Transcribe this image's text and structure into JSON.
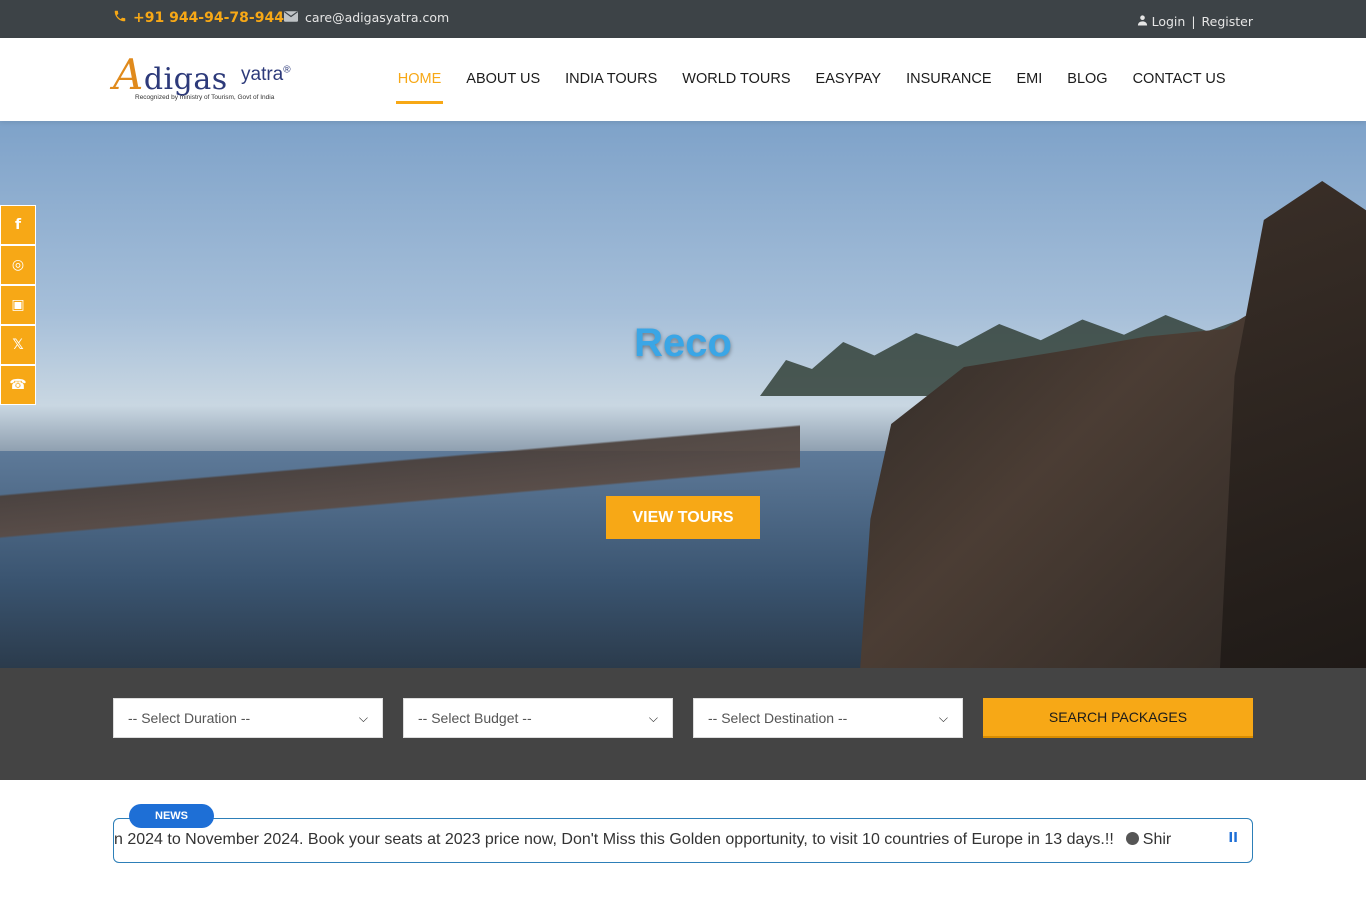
{
  "topbar": {
    "phone": "+91 944-94-78-944",
    "email": "care@adigasyatra.com",
    "login": "Login",
    "register": "Register"
  },
  "logo": {
    "brand_initial": "A",
    "brand_rest": "digas",
    "sub": "yatra",
    "reg": "®",
    "tagline": "Recognized by ministry of Tourism, Govt of India"
  },
  "nav": {
    "items": [
      "HOME",
      "ABOUT US",
      "INDIA TOURS",
      "WORLD TOURS",
      "EASYPAY",
      "INSURANCE",
      "EMI",
      "BLOG",
      "CONTACT US"
    ],
    "active": "HOME"
  },
  "hero": {
    "title": "Reco",
    "cta": "VIEW TOURS"
  },
  "social": {
    "icons": [
      "facebook-icon",
      "whatsapp-icon",
      "instagram-icon",
      "x-icon",
      "phone-icon"
    ],
    "glyphs": [
      "f",
      "◎",
      "▣",
      "𝕏",
      "☎"
    ]
  },
  "search": {
    "duration_placeholder": "-- Select Duration --",
    "budget_placeholder": "-- Select Budget --",
    "destination_placeholder": "-- Select Destination --",
    "button": "SEARCH PACKAGES"
  },
  "news": {
    "badge": "NEWS",
    "ticker_text": "n 2024 to November 2024. Book your seats at 2023 price now, Don't Miss this Golden opportunity, to visit 10 countries of Europe in 13 days.!!",
    "ticker_next": "Shir",
    "pause_glyph": "II"
  },
  "colors": {
    "accent": "#f7a816",
    "topbar_bg": "#3d4347",
    "news_blue": "#1e6fd6",
    "hero_title": "#3aa6e6"
  }
}
